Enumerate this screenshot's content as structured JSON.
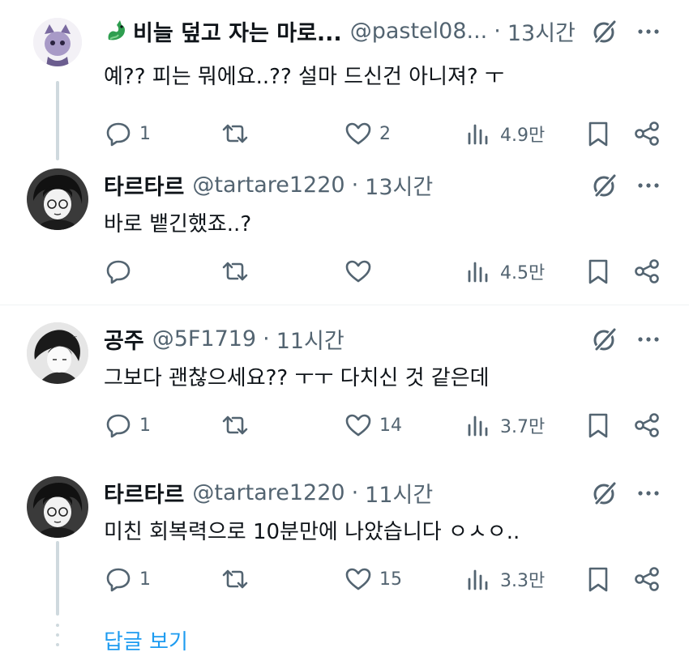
{
  "tweets": [
    {
      "display_name": "비늘 덮고 자는 마로...",
      "name_emoji": "dragon-emoji",
      "handle": "@pastel08...",
      "separator": "·",
      "time": "13시간",
      "text": "예?? 피는 뭐에요..?? 설마 드신건 아니져? ㅜ",
      "replies": "1",
      "retweets": "",
      "likes": "2",
      "views": "4.9만"
    },
    {
      "display_name": "타르타르",
      "handle": "@tartare1220",
      "separator": "·",
      "time": "13시간",
      "text": "바로 뱉긴했죠..?",
      "replies": "",
      "retweets": "",
      "likes": "",
      "views": "4.5만"
    },
    {
      "display_name": "공주",
      "handle": "@5F1719",
      "separator": "·",
      "time": "11시간",
      "text": "그보다 괜찮으세요?? ㅜㅜ 다치신 것 같은데",
      "replies": "1",
      "retweets": "",
      "likes": "14",
      "views": "3.7만"
    },
    {
      "display_name": "타르타르",
      "handle": "@tartare1220",
      "separator": "·",
      "time": "11시간",
      "text": "미친 회복력으로 10분만에 나았습니다 ㅇㅅㅇ..",
      "replies": "1",
      "retweets": "",
      "likes": "15",
      "views": "3.3만"
    }
  ],
  "show_replies_label": "답글 보기",
  "colors": {
    "text": "#0f1419",
    "secondary": "#536471",
    "link": "#1d9bf0",
    "thread_line": "#cfd9de"
  }
}
